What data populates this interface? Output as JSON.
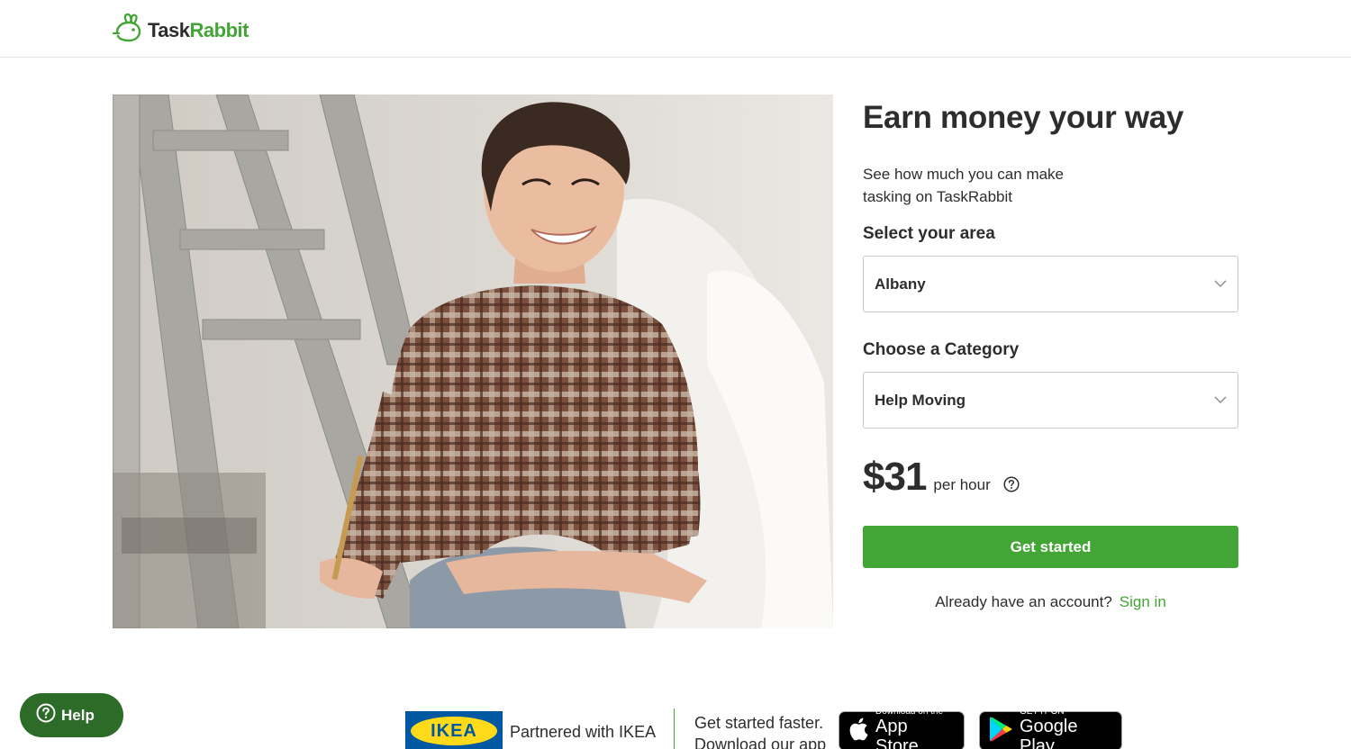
{
  "brand": {
    "name_part1": "Task",
    "name_part2": "Rabbit",
    "accent": "#43a535"
  },
  "hero": {
    "image_desc": "woman smiling in plaid shirt with ladder"
  },
  "panel": {
    "headline": "Earn money your way",
    "subtext": "See how much you can make tasking on TaskRabbit",
    "area_label": "Select your area",
    "area_value": "Albany",
    "category_label": "Choose a Category",
    "category_value": "Help Moving",
    "rate_amount": "$31",
    "rate_unit": "per hour",
    "cta_label": "Get started",
    "account_text": "Already have an account?",
    "signin_label": "Sign in"
  },
  "help": {
    "label": "Help"
  },
  "footer": {
    "ikea_logo": "IKEA",
    "ikea_text": "Partnered with IKEA",
    "faster_line1": "Get started faster.",
    "faster_line2": "Download our app",
    "appstore_small": "Download on the",
    "appstore_big": "App Store",
    "gplay_small": "GET IT ON",
    "gplay_big": "Google Play"
  }
}
